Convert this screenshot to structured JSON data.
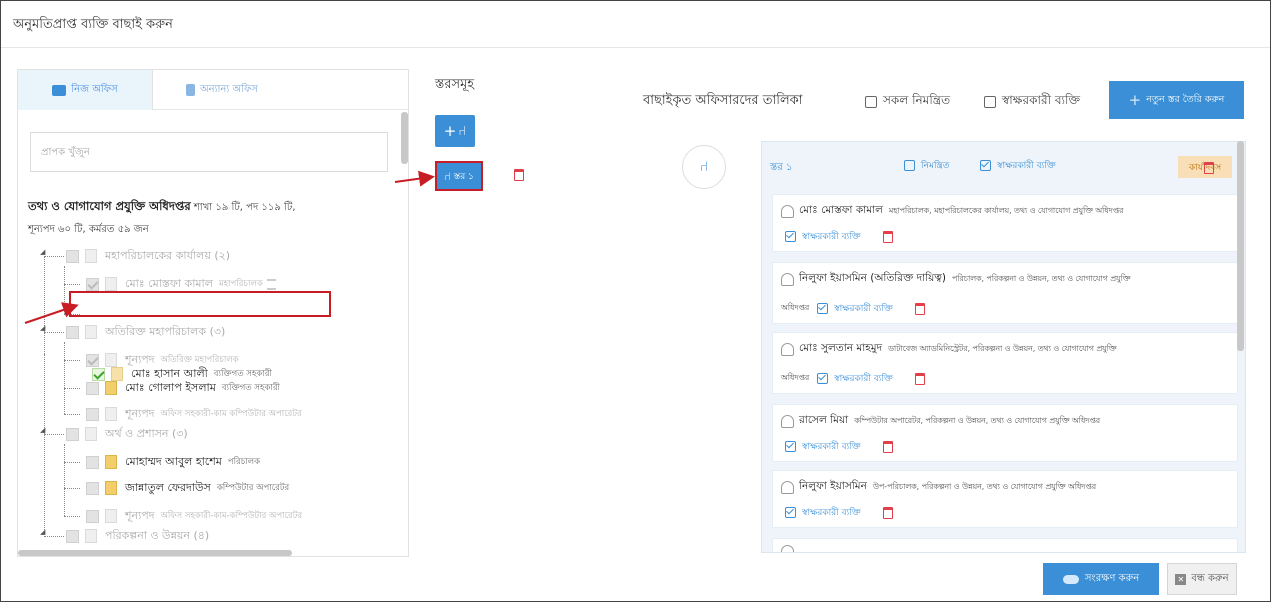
{
  "modal": {
    "title": "অনুমতিপ্রাপ্ত ব্যক্তি বাছাই করুন"
  },
  "left": {
    "tabs": [
      {
        "label": "নিজ অফিস",
        "icon": "briefcase-icon"
      },
      {
        "label": "অন্যান্য অফিস",
        "icon": "building-icon"
      }
    ],
    "search_placeholder": "প্রাপক খুঁজুন",
    "org": {
      "name": "তথ্য ও যোগাযোগ প্রযুক্তি অধিদপ্তর",
      "meta_line1": " শাখা ১৯ টি, পদ ১১৯ টি,",
      "meta_line2": "শূন্যপদ ৬০ টি, কর্মরত ৫৯ জন"
    },
    "tree": [
      {
        "type": "group",
        "label": "মহাপরিচালকের কার্যালয় (২)"
      },
      {
        "type": "person",
        "name": "মোঃ মোস্তফা কামাল",
        "designation": "মহাপরিচালক",
        "state": "disabled",
        "hourglass": true
      },
      {
        "type": "person",
        "name": "মোঃ হাসান আলী",
        "designation": "ব্যক্তিগত সহকারী",
        "state": "checked"
      },
      {
        "type": "group",
        "label": "অতিরিক্ত মহাপরিচালক (৩)"
      },
      {
        "type": "person",
        "name": "শূন্যপদ",
        "designation": "অতিরিক্ত মহাপরিচালক",
        "state": "disabled"
      },
      {
        "type": "person",
        "name": "মোঃ গোলাপ ইসলাম",
        "designation": "ব্যক্তিগত সহকারী",
        "state": "normal"
      },
      {
        "type": "person",
        "name": "শূন্যপদ",
        "designation": "অফিস সহকারী-কাম কম্পিউটার অপারেটর",
        "state": "vacant"
      },
      {
        "type": "group",
        "label": "অর্থ ও প্রশাসন (৩)"
      },
      {
        "type": "person",
        "name": "মোহাম্মদ আবুল হাশেম",
        "designation": "পরিচালক",
        "state": "normal"
      },
      {
        "type": "person",
        "name": "জান্নাতুল ফেরদাউস",
        "designation": "কম্পিউটার অপারেটর",
        "state": "normal"
      },
      {
        "type": "person",
        "name": "শূন্যপদ",
        "designation": "অফিস সহকারী-কাম-কম্পিউটার অপারেটর",
        "state": "vacant"
      },
      {
        "type": "group",
        "label": "পরিকল্পনা ও উন্নয়ন (৪)"
      }
    ]
  },
  "middle": {
    "title": "স্তরসমূহ",
    "layer_chip": "স্তর ১"
  },
  "right": {
    "title": "বাছাইকৃত অফিসারদের তালিকা",
    "all_invited_label": "সকল নিমন্ত্রিত",
    "signatory_label": "স্বাক্ষরকারী ব্যক্তি",
    "new_layer_button": "নতুন স্তর তৈরি করুন",
    "layer": {
      "name": "স্তর ১",
      "invited_label": "নিমন্ত্রিত",
      "signatory_label": "স্বাক্ষরকারী ব্যক্তি",
      "tag": "কার্যদিবস"
    },
    "officers": [
      {
        "name": "মোঃ মোস্তফা কামাল",
        "desc": "মহাপরিচালক, মহাপরিচালকের কার্যালয়, তথ্য ও যোগাযোগ প্রযুক্তি অধিদপ্তর",
        "desc2": "",
        "sign": "স্বাক্ষরকারী ব্যক্তি"
      },
      {
        "name": "নিলুফা ইয়াসমিন (অতিরিক্ত দায়িত্ব)",
        "desc": "পরিচালক, পরিকল্পনা ও উন্নয়ন, তথ্য ও যোগাযোগ প্রযুক্তি",
        "desc2": "অধিদপ্তর",
        "sign": "স্বাক্ষরকারী ব্যক্তি"
      },
      {
        "name": "মোঃ সুলতান মাহমুদ",
        "desc": "ডাটাবেজ অ্যাডমিনিস্ট্রেটর, পরিকল্পনা ও উন্নয়ন, তথ্য ও যোগাযোগ প্রযুক্তি",
        "desc2": "অধিদপ্তর",
        "sign": "স্বাক্ষরকারী ব্যক্তি"
      },
      {
        "name": "রাসেল মিয়া",
        "desc": "কম্পিউটার অপারেটর, পরিকল্পনা ও উন্নয়ন, তথ্য ও যোগাযোগ প্রযুক্তি অধিদপ্তর",
        "desc2": "",
        "sign": "স্বাক্ষরকারী ব্যক্তি"
      },
      {
        "name": "নিলুফা ইয়াসমিন",
        "desc": "উপ-পরিচালক, পরিকল্পনা ও উন্নয়ন, তথ্য ও যোগাযোগ প্রযুক্তি অধিদপ্তর",
        "desc2": "",
        "sign": "স্বাক্ষরকারী ব্যক্তি"
      }
    ]
  },
  "footer": {
    "save_button": "সংরক্ষণ করুন",
    "close_button": "বন্ধ করুন"
  },
  "colors": {
    "accent": "#3a8fd6",
    "danger": "#e0404a",
    "highlight": "#c81d25",
    "tag_bg": "#f8dfb8"
  }
}
